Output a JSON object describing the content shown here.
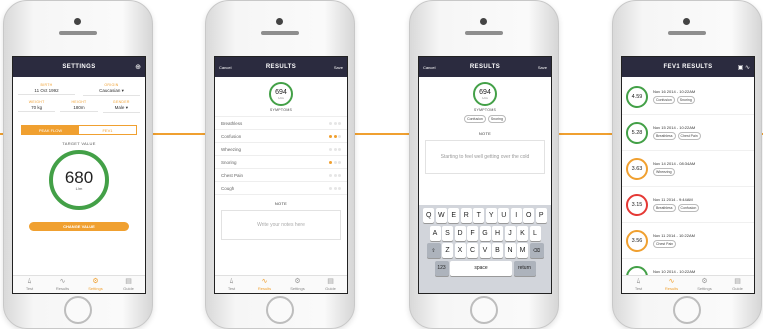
{
  "colors": {
    "accent": "#f0a030",
    "navbar": "#2b2b3f",
    "green": "#43a047",
    "red": "#e53935"
  },
  "tabs": [
    {
      "label": "Test",
      "icon": "lungs-icon"
    },
    {
      "label": "Results",
      "icon": "chart-icon"
    },
    {
      "label": "Settings",
      "icon": "gear-icon"
    },
    {
      "label": "Guide",
      "icon": "book-icon"
    }
  ],
  "settings": {
    "title": "SETTINGS",
    "birth_label": "BIRTH",
    "birth_value": "11 Oct 1992",
    "origin_label": "ORIGIN",
    "origin_value": "Caucasian",
    "weight_label": "WEIGHT",
    "weight_value": "70 kg",
    "height_label": "HEIGHT",
    "height_value": "180m",
    "gender_label": "GENDER",
    "gender_value": "Male",
    "seg_peak": "PEAK FLOW",
    "seg_fev1": "FEV1",
    "target_label": "TARGET VALUE",
    "target_value": "680",
    "target_unit": "L/m",
    "change_button": "CHANGE VALUE"
  },
  "results1": {
    "cancel": "Cancel",
    "title": "RESULTS",
    "save": "Save",
    "value": "694",
    "unit": "L/m",
    "symptoms_label": "SYMPTOMS",
    "symptoms": [
      {
        "name": "Breathless",
        "level": 0
      },
      {
        "name": "Confusion",
        "level": 2
      },
      {
        "name": "Wheezing",
        "level": 0
      },
      {
        "name": "Snoring",
        "level": 1
      },
      {
        "name": "Chest Pain",
        "level": 0
      },
      {
        "name": "Cough",
        "level": 0
      }
    ],
    "note_label": "NOTE",
    "note_placeholder": "Write your notes here"
  },
  "results2": {
    "cancel": "Cancel",
    "title": "RESULTS",
    "save": "Save",
    "value": "694",
    "unit": "L/m",
    "symptoms_label": "SYMPTOMS",
    "chips": [
      "Confusion",
      "Snoring"
    ],
    "note_label": "NOTE",
    "note_text": "Starting to feel well getting over the cold",
    "keys_row1": [
      "Q",
      "W",
      "E",
      "R",
      "T",
      "Y",
      "U",
      "I",
      "O",
      "P"
    ],
    "keys_row2": [
      "A",
      "S",
      "D",
      "F",
      "G",
      "H",
      "J",
      "K",
      "L"
    ],
    "keys_row3": [
      "Z",
      "X",
      "C",
      "V",
      "B",
      "N",
      "M"
    ],
    "key_123": "123",
    "key_space": "space",
    "key_return": "return"
  },
  "fev1": {
    "title": "FEV1 RESULTS",
    "rows": [
      {
        "value": "4.59",
        "status": "green",
        "date": "Nov 16 2014 - 10:22AM",
        "chips": [
          "Confusion",
          "Snoring"
        ]
      },
      {
        "value": "5.28",
        "status": "green",
        "date": "Nov 15 2014 - 10:22AM",
        "chips": [
          "Breathless",
          "Chest Pain"
        ]
      },
      {
        "value": "3.63",
        "status": "orange",
        "date": "Nov 14 2014 - 08:34AM",
        "chips": [
          "Wheezing"
        ]
      },
      {
        "value": "3.15",
        "status": "red",
        "date": "Nov 11 2014 - 9:44AM",
        "chips": [
          "Breathless",
          "Confusion"
        ]
      },
      {
        "value": "3.56",
        "status": "orange",
        "date": "Nov 11 2014 - 10:22AM",
        "chips": [
          "Chest Pain"
        ]
      },
      {
        "value": "",
        "status": "green",
        "date": "Nov 10 2014 - 10:22AM",
        "chips": [
          "Breathless"
        ]
      }
    ]
  }
}
